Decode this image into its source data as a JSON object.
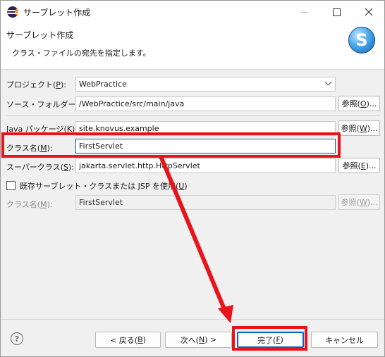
{
  "window": {
    "title": "サーブレット作成",
    "minimize_icon": "minimize-icon",
    "maximize_icon": "maximize-icon",
    "close_icon": "close-icon"
  },
  "banner": {
    "title": "サーブレット作成",
    "description": "クラス・ファイルの宛先を指定します。",
    "logo_letter": "S"
  },
  "form": {
    "project": {
      "label_text": "プロジェクト(",
      "label_mnemonic": "P",
      "label_suffix": "):",
      "value": "WebPractice"
    },
    "source_folder": {
      "label_text": "ソース・フォルダー(",
      "label_mnemonic": "D",
      "label_suffix": "):",
      "value": "/WebPractice/src/main/java",
      "browse_text": "参照(",
      "browse_mnemonic": "O",
      "browse_suffix": ")..."
    },
    "java_package": {
      "label_text": "Java パッケージ(",
      "label_mnemonic": "K",
      "label_suffix": "):",
      "value": "site.knovus.example",
      "browse_text": "参照(",
      "browse_mnemonic": "W",
      "browse_suffix": ")..."
    },
    "class_name": {
      "label_text": "クラス名(",
      "label_mnemonic": "M",
      "label_suffix": "):",
      "value": "FirstServlet"
    },
    "superclass": {
      "label_text": "スーパークラス(",
      "label_mnemonic": "S",
      "label_suffix": "):",
      "value": "jakarta.servlet.http.HttpServlet",
      "browse_text": "参照(",
      "browse_mnemonic": "E",
      "browse_suffix": ")..."
    },
    "existing_servlet": {
      "label_text": "既存サーブレット・クラスまたは JSP を使用(",
      "label_mnemonic": "U",
      "label_suffix": ")",
      "checked": false
    },
    "existing_class_name": {
      "label_text": "クラス名(",
      "label_mnemonic": "M",
      "label_suffix": "):",
      "value": "FirstServlet",
      "browse_text": "参照(",
      "browse_mnemonic": "W",
      "browse_suffix": ")..."
    }
  },
  "buttons": {
    "help_icon": "help-icon",
    "help_glyph": "?",
    "back": {
      "text": "< 戻る(",
      "mnemonic": "B",
      "suffix": ")"
    },
    "next": {
      "text": "次へ(",
      "mnemonic": "N",
      "suffix": ") >"
    },
    "finish": {
      "text": "完了(",
      "mnemonic": "F",
      "suffix": ")"
    },
    "cancel": {
      "text": "キャンセル"
    }
  },
  "annotation": {
    "color": "#e8141b"
  }
}
